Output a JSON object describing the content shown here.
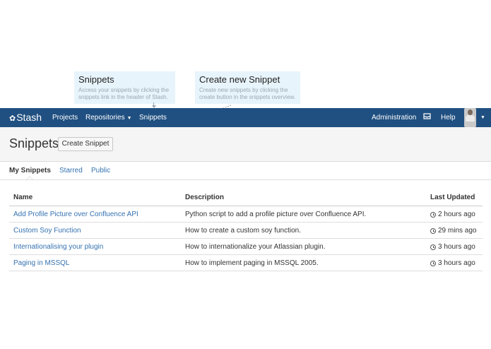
{
  "callouts": {
    "snippets": {
      "title": "Snippets",
      "text": "Access your snippets by clicking the snippets link in the header of Stash."
    },
    "create": {
      "title": "Create new Snippet",
      "text": "Create new snippets by clicking the create button in the snippets overview."
    }
  },
  "topnav": {
    "logo": "Stash",
    "logo_icon": "stash-logo-icon",
    "items": [
      "Projects",
      "Repositories",
      "Snippets"
    ],
    "admin": "Administration",
    "inbox_icon": "inbox-icon",
    "help": "Help",
    "avatar": "user-avatar",
    "color": "#205081"
  },
  "page": {
    "title": "Snippets",
    "create_button": "Create Snippet"
  },
  "tabs": [
    "My Snippets",
    "Starred",
    "Public"
  ],
  "table": {
    "headers": [
      "Name",
      "Description",
      "Last Updated"
    ],
    "rows": [
      {
        "name": "Add Profile Picture over Confluence API",
        "description": "Python script to add a profile picture over Confluence API.",
        "updated": "2 hours ago"
      },
      {
        "name": "Custom Soy Function",
        "description": "How to create a custom soy function.",
        "updated": "29 mins ago"
      },
      {
        "name": "Internationalising your plugin",
        "description": "How to internationalize your Atlassian plugin.",
        "updated": "3 hours ago"
      },
      {
        "name": "Paging in MSSQL",
        "description": "How to implement paging in MSSQL 2005.",
        "updated": "3 hours ago"
      }
    ]
  },
  "colors": {
    "link": "#3572b0",
    "callout_bg": "#e8f4fb"
  }
}
